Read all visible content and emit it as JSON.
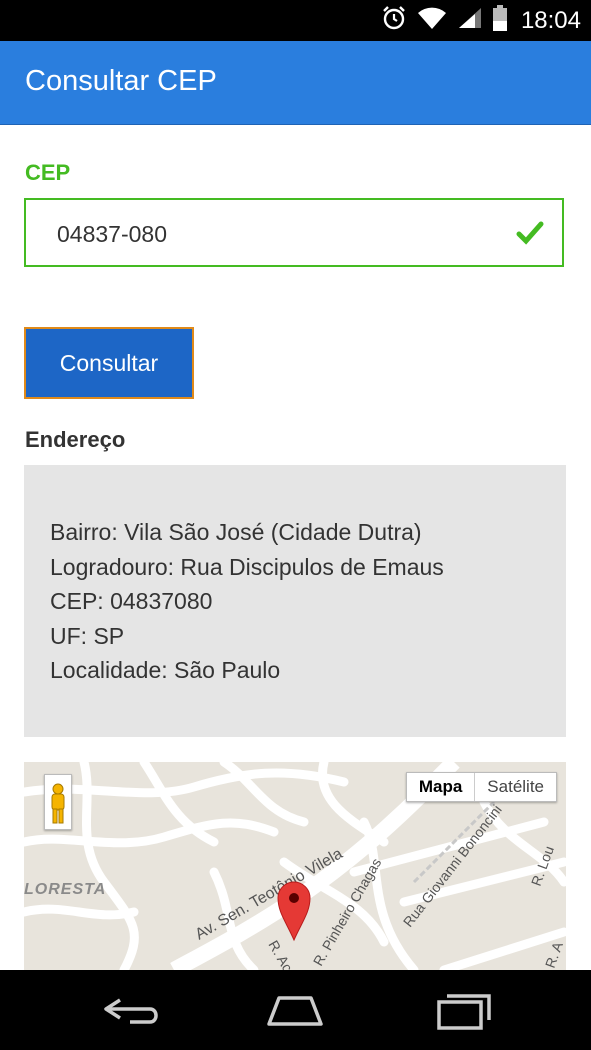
{
  "status_bar": {
    "time": "18:04"
  },
  "app_bar": {
    "title": "Consultar CEP"
  },
  "form": {
    "cep_label": "CEP",
    "cep_value": "04837-080",
    "button_label": "Consultar"
  },
  "address": {
    "title": "Endereço",
    "lines": [
      "Bairro: Vila São José (Cidade Dutra)",
      "Logradouro: Rua Discipulos de Emaus",
      "CEP: 04837080",
      "UF: SP",
      "Localidade: São Paulo"
    ]
  },
  "map": {
    "toggle_map": "Mapa",
    "toggle_satellite": "Satélite",
    "labels": {
      "area": "LORESTA",
      "avenue": "Av. Sen. Teotônio Vilela",
      "street1": "R. Pinheiro Chagas",
      "street2": "Rua Giovanni Bononcini",
      "street3": "R. Ac",
      "street4": "R. Lou",
      "street5": "R. A"
    }
  },
  "colors": {
    "primary": "#2a7ede",
    "success": "#44bb22",
    "button": "#1d66c6",
    "button_border": "#e08a1a",
    "marker": "#e53935"
  }
}
